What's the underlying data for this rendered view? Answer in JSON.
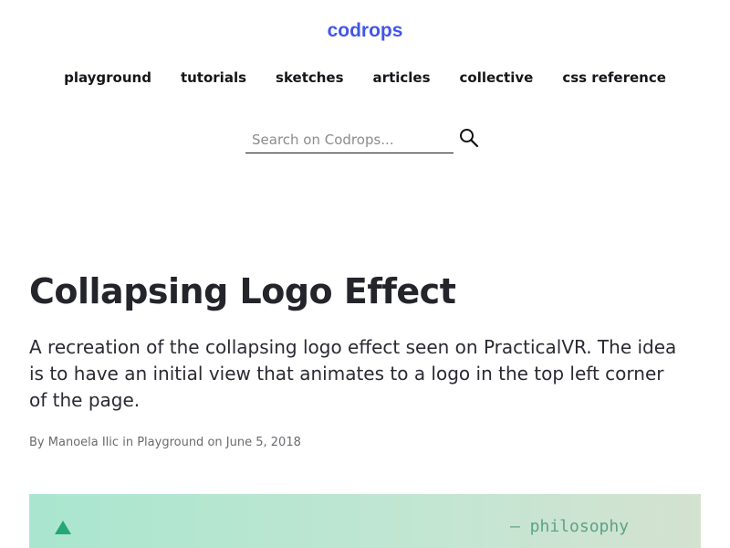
{
  "site": {
    "logo": "codrops"
  },
  "nav": {
    "items": [
      {
        "label": "playground"
      },
      {
        "label": "tutorials"
      },
      {
        "label": "sketches"
      },
      {
        "label": "articles"
      },
      {
        "label": "collective"
      },
      {
        "label": "css reference"
      }
    ]
  },
  "search": {
    "placeholder": "Search on Codrops...",
    "value": "",
    "icon": "search-icon"
  },
  "article": {
    "title": "Collapsing Logo Effect",
    "description": "A recreation of the collapsing logo effect seen on PracticalVR. The idea is to have an initial view that animates to a logo in the top left corner of the page.",
    "byline": {
      "prefix": "By",
      "author": "Manoela Ilic",
      "in": "in",
      "category": "Playground",
      "on": "on",
      "date": "June 5, 2018"
    }
  },
  "banner": {
    "text": "– philosophy",
    "icon": "triangle-icon",
    "colors": {
      "gradient_start": "#a9e6cf",
      "gradient_end": "#d4e2d0",
      "accent": "#25a776"
    }
  },
  "colors": {
    "brand": "#4256e6",
    "text": "#1f1f24",
    "muted": "#6b6b70"
  }
}
